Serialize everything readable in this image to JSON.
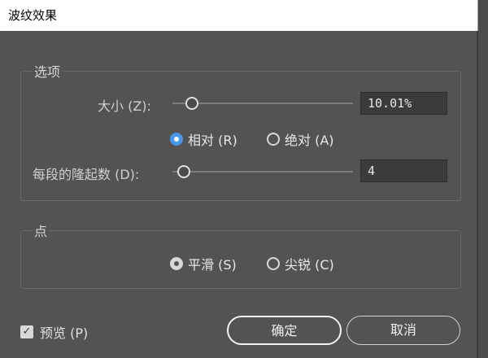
{
  "window": {
    "title": "波纹效果"
  },
  "options_group": {
    "title": "选项",
    "size": {
      "label": "大小 (Z):",
      "value": "10.01%"
    },
    "mode": {
      "relative_label": "相对 (R)",
      "absolute_label": "绝对 (A)",
      "selected": "relative"
    },
    "ridges": {
      "label": "每段的隆起数 (D):",
      "value": "4"
    }
  },
  "points_group": {
    "title": "点",
    "smooth_label": "平滑 (S)",
    "corner_label": "尖锐 (C)",
    "selected": "smooth"
  },
  "footer": {
    "preview_label": "预览 (P)",
    "preview_checked": true,
    "ok_label": "确定",
    "cancel_label": "取消"
  },
  "colors": {
    "accent": "#4b95e6",
    "dialog_bg": "#535353"
  },
  "icons": {
    "preview_checkbox": "checkmark-icon"
  }
}
